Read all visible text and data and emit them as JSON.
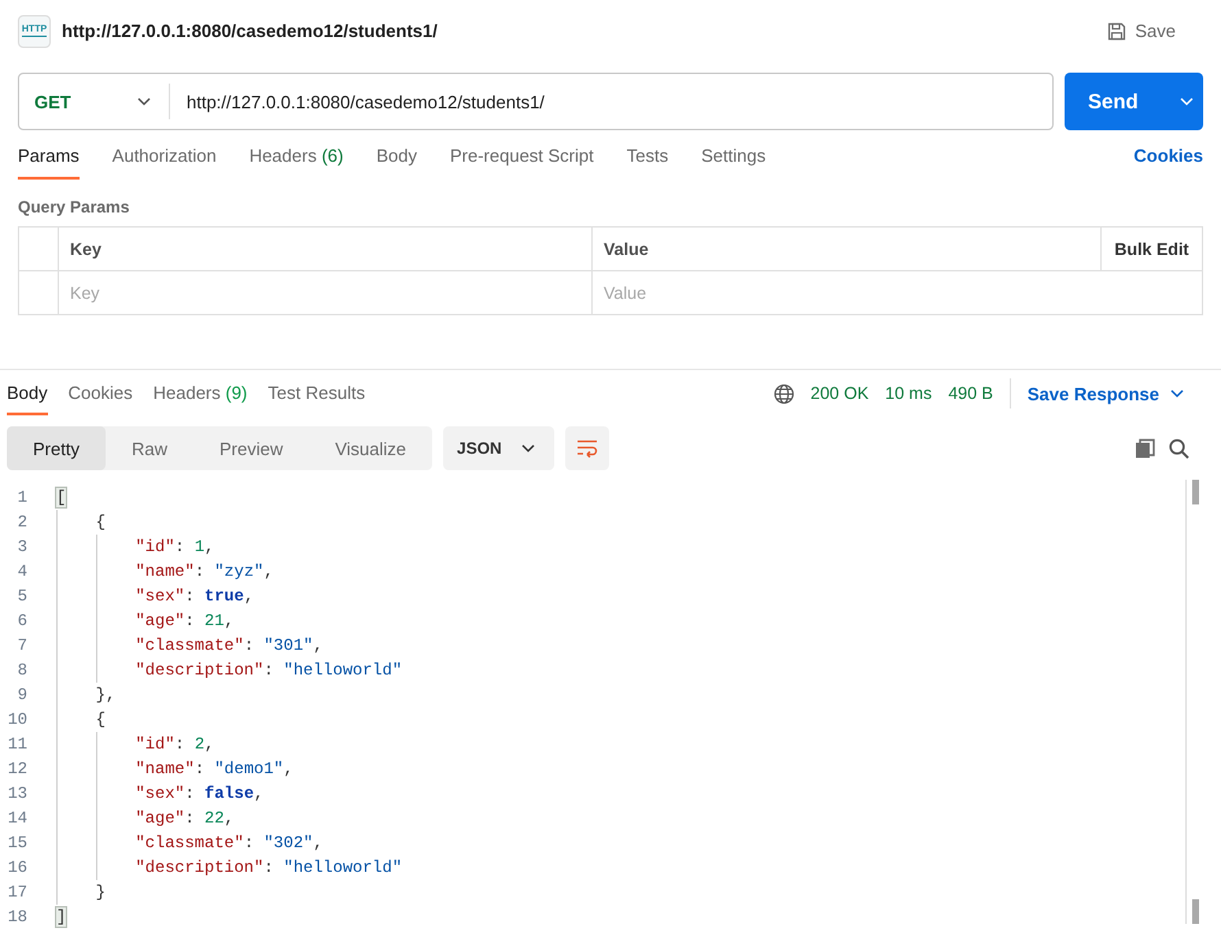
{
  "header": {
    "title": "http://127.0.0.1:8080/casedemo12/students1/",
    "icon_text": "HTTP",
    "save": "Save"
  },
  "request": {
    "method": "GET",
    "url": "http://127.0.0.1:8080/casedemo12/students1/",
    "send": "Send"
  },
  "request_tabs": [
    {
      "label": "Params",
      "selected": true
    },
    {
      "label": "Authorization",
      "selected": false
    },
    {
      "label": "Headers",
      "count": "(6)",
      "selected": false
    },
    {
      "label": "Body",
      "selected": false
    },
    {
      "label": "Pre-request Script",
      "selected": false
    },
    {
      "label": "Tests",
      "selected": false
    },
    {
      "label": "Settings",
      "selected": false
    }
  ],
  "cookies_link": "Cookies",
  "query_params": {
    "title": "Query Params",
    "columns": [
      "Key",
      "Value"
    ],
    "bulk_edit": "Bulk Edit",
    "placeholders": [
      "Key",
      "Value"
    ]
  },
  "response_tabs": [
    {
      "label": "Body",
      "selected": true
    },
    {
      "label": "Cookies",
      "selected": false
    },
    {
      "label": "Headers",
      "count": "(9)",
      "selected": false
    },
    {
      "label": "Test Results",
      "selected": false
    }
  ],
  "response_meta": {
    "status": "200 OK",
    "time": "10 ms",
    "size": "490 B",
    "save_response": "Save Response"
  },
  "view_modes": [
    {
      "label": "Pretty",
      "selected": true
    },
    {
      "label": "Raw",
      "selected": false
    },
    {
      "label": "Preview",
      "selected": false
    },
    {
      "label": "Visualize",
      "selected": false
    }
  ],
  "format": "JSON",
  "code_lines": [
    {
      "number": "1",
      "tokens": [
        {
          "kind": "bracket",
          "text": "["
        }
      ]
    },
    {
      "number": "2",
      "tokens": [
        {
          "kind": "indent"
        },
        {
          "kind": "punct",
          "text": "{"
        }
      ]
    },
    {
      "number": "3",
      "tokens": [
        {
          "kind": "indent"
        },
        {
          "kind": "indent"
        },
        {
          "kind": "key",
          "text": "\"id\""
        },
        {
          "kind": "punct",
          "text": ": "
        },
        {
          "kind": "number",
          "text": "1"
        },
        {
          "kind": "punct",
          "text": ","
        }
      ]
    },
    {
      "number": "4",
      "tokens": [
        {
          "kind": "indent"
        },
        {
          "kind": "indent"
        },
        {
          "kind": "key",
          "text": "\"name\""
        },
        {
          "kind": "punct",
          "text": ": "
        },
        {
          "kind": "string",
          "text": "\"zyz\""
        },
        {
          "kind": "punct",
          "text": ","
        }
      ]
    },
    {
      "number": "5",
      "tokens": [
        {
          "kind": "indent"
        },
        {
          "kind": "indent"
        },
        {
          "kind": "key",
          "text": "\"sex\""
        },
        {
          "kind": "punct",
          "text": ": "
        },
        {
          "kind": "bool",
          "text": "true"
        },
        {
          "kind": "punct",
          "text": ","
        }
      ]
    },
    {
      "number": "6",
      "tokens": [
        {
          "kind": "indent"
        },
        {
          "kind": "indent"
        },
        {
          "kind": "key",
          "text": "\"age\""
        },
        {
          "kind": "punct",
          "text": ": "
        },
        {
          "kind": "number",
          "text": "21"
        },
        {
          "kind": "punct",
          "text": ","
        }
      ]
    },
    {
      "number": "7",
      "tokens": [
        {
          "kind": "indent"
        },
        {
          "kind": "indent"
        },
        {
          "kind": "key",
          "text": "\"classmate\""
        },
        {
          "kind": "punct",
          "text": ": "
        },
        {
          "kind": "string",
          "text": "\"301\""
        },
        {
          "kind": "punct",
          "text": ","
        }
      ]
    },
    {
      "number": "8",
      "tokens": [
        {
          "kind": "indent"
        },
        {
          "kind": "indent"
        },
        {
          "kind": "key",
          "text": "\"description\""
        },
        {
          "kind": "punct",
          "text": ": "
        },
        {
          "kind": "string",
          "text": "\"helloworld\""
        }
      ]
    },
    {
      "number": "9",
      "tokens": [
        {
          "kind": "indent"
        },
        {
          "kind": "punct",
          "text": "},"
        }
      ]
    },
    {
      "number": "10",
      "tokens": [
        {
          "kind": "indent"
        },
        {
          "kind": "punct",
          "text": "{"
        }
      ]
    },
    {
      "number": "11",
      "tokens": [
        {
          "kind": "indent"
        },
        {
          "kind": "indent"
        },
        {
          "kind": "key",
          "text": "\"id\""
        },
        {
          "kind": "punct",
          "text": ": "
        },
        {
          "kind": "number",
          "text": "2"
        },
        {
          "kind": "punct",
          "text": ","
        }
      ]
    },
    {
      "number": "12",
      "tokens": [
        {
          "kind": "indent"
        },
        {
          "kind": "indent"
        },
        {
          "kind": "key",
          "text": "\"name\""
        },
        {
          "kind": "punct",
          "text": ": "
        },
        {
          "kind": "string",
          "text": "\"demo1\""
        },
        {
          "kind": "punct",
          "text": ","
        }
      ]
    },
    {
      "number": "13",
      "tokens": [
        {
          "kind": "indent"
        },
        {
          "kind": "indent"
        },
        {
          "kind": "key",
          "text": "\"sex\""
        },
        {
          "kind": "punct",
          "text": ": "
        },
        {
          "kind": "bool",
          "text": "false"
        },
        {
          "kind": "punct",
          "text": ","
        }
      ]
    },
    {
      "number": "14",
      "tokens": [
        {
          "kind": "indent"
        },
        {
          "kind": "indent"
        },
        {
          "kind": "key",
          "text": "\"age\""
        },
        {
          "kind": "punct",
          "text": ": "
        },
        {
          "kind": "number",
          "text": "22"
        },
        {
          "kind": "punct",
          "text": ","
        }
      ]
    },
    {
      "number": "15",
      "tokens": [
        {
          "kind": "indent"
        },
        {
          "kind": "indent"
        },
        {
          "kind": "key",
          "text": "\"classmate\""
        },
        {
          "kind": "punct",
          "text": ": "
        },
        {
          "kind": "string",
          "text": "\"302\""
        },
        {
          "kind": "punct",
          "text": ","
        }
      ]
    },
    {
      "number": "16",
      "tokens": [
        {
          "kind": "indent"
        },
        {
          "kind": "indent"
        },
        {
          "kind": "key",
          "text": "\"description\""
        },
        {
          "kind": "punct",
          "text": ": "
        },
        {
          "kind": "string",
          "text": "\"helloworld\""
        }
      ]
    },
    {
      "number": "17",
      "tokens": [
        {
          "kind": "indent"
        },
        {
          "kind": "punct",
          "text": "}"
        }
      ]
    },
    {
      "number": "18",
      "tokens": [
        {
          "kind": "bracket",
          "text": "]"
        }
      ]
    }
  ]
}
